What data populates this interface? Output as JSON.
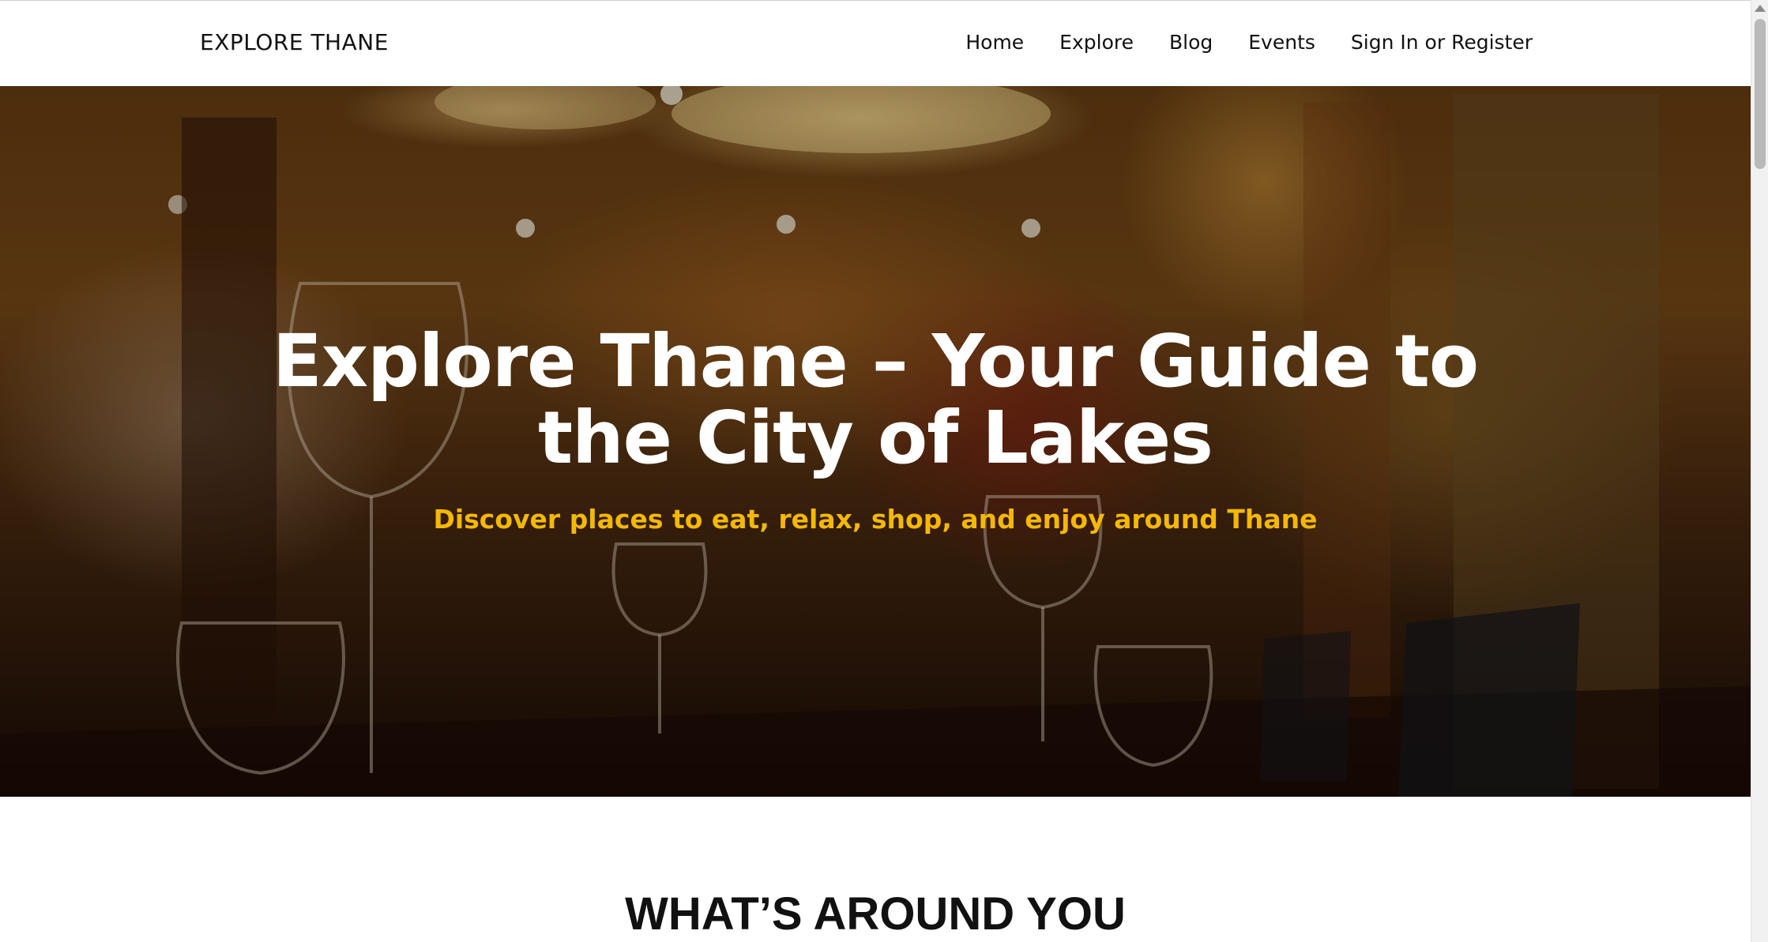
{
  "header": {
    "brand": "EXPLORE THANE",
    "nav": [
      "Home",
      "Explore",
      "Blog",
      "Events",
      "Sign In or Register"
    ]
  },
  "hero": {
    "title": "Explore Thane – Your Guide to the City of Lakes",
    "subtitle": "Discover places to eat, relax, shop, and enjoy around Thane",
    "subtitle_color": "#f5b800",
    "background_description_icon": "restaurant-photo"
  },
  "section": {
    "title": "WHAT’S AROUND YOU"
  }
}
